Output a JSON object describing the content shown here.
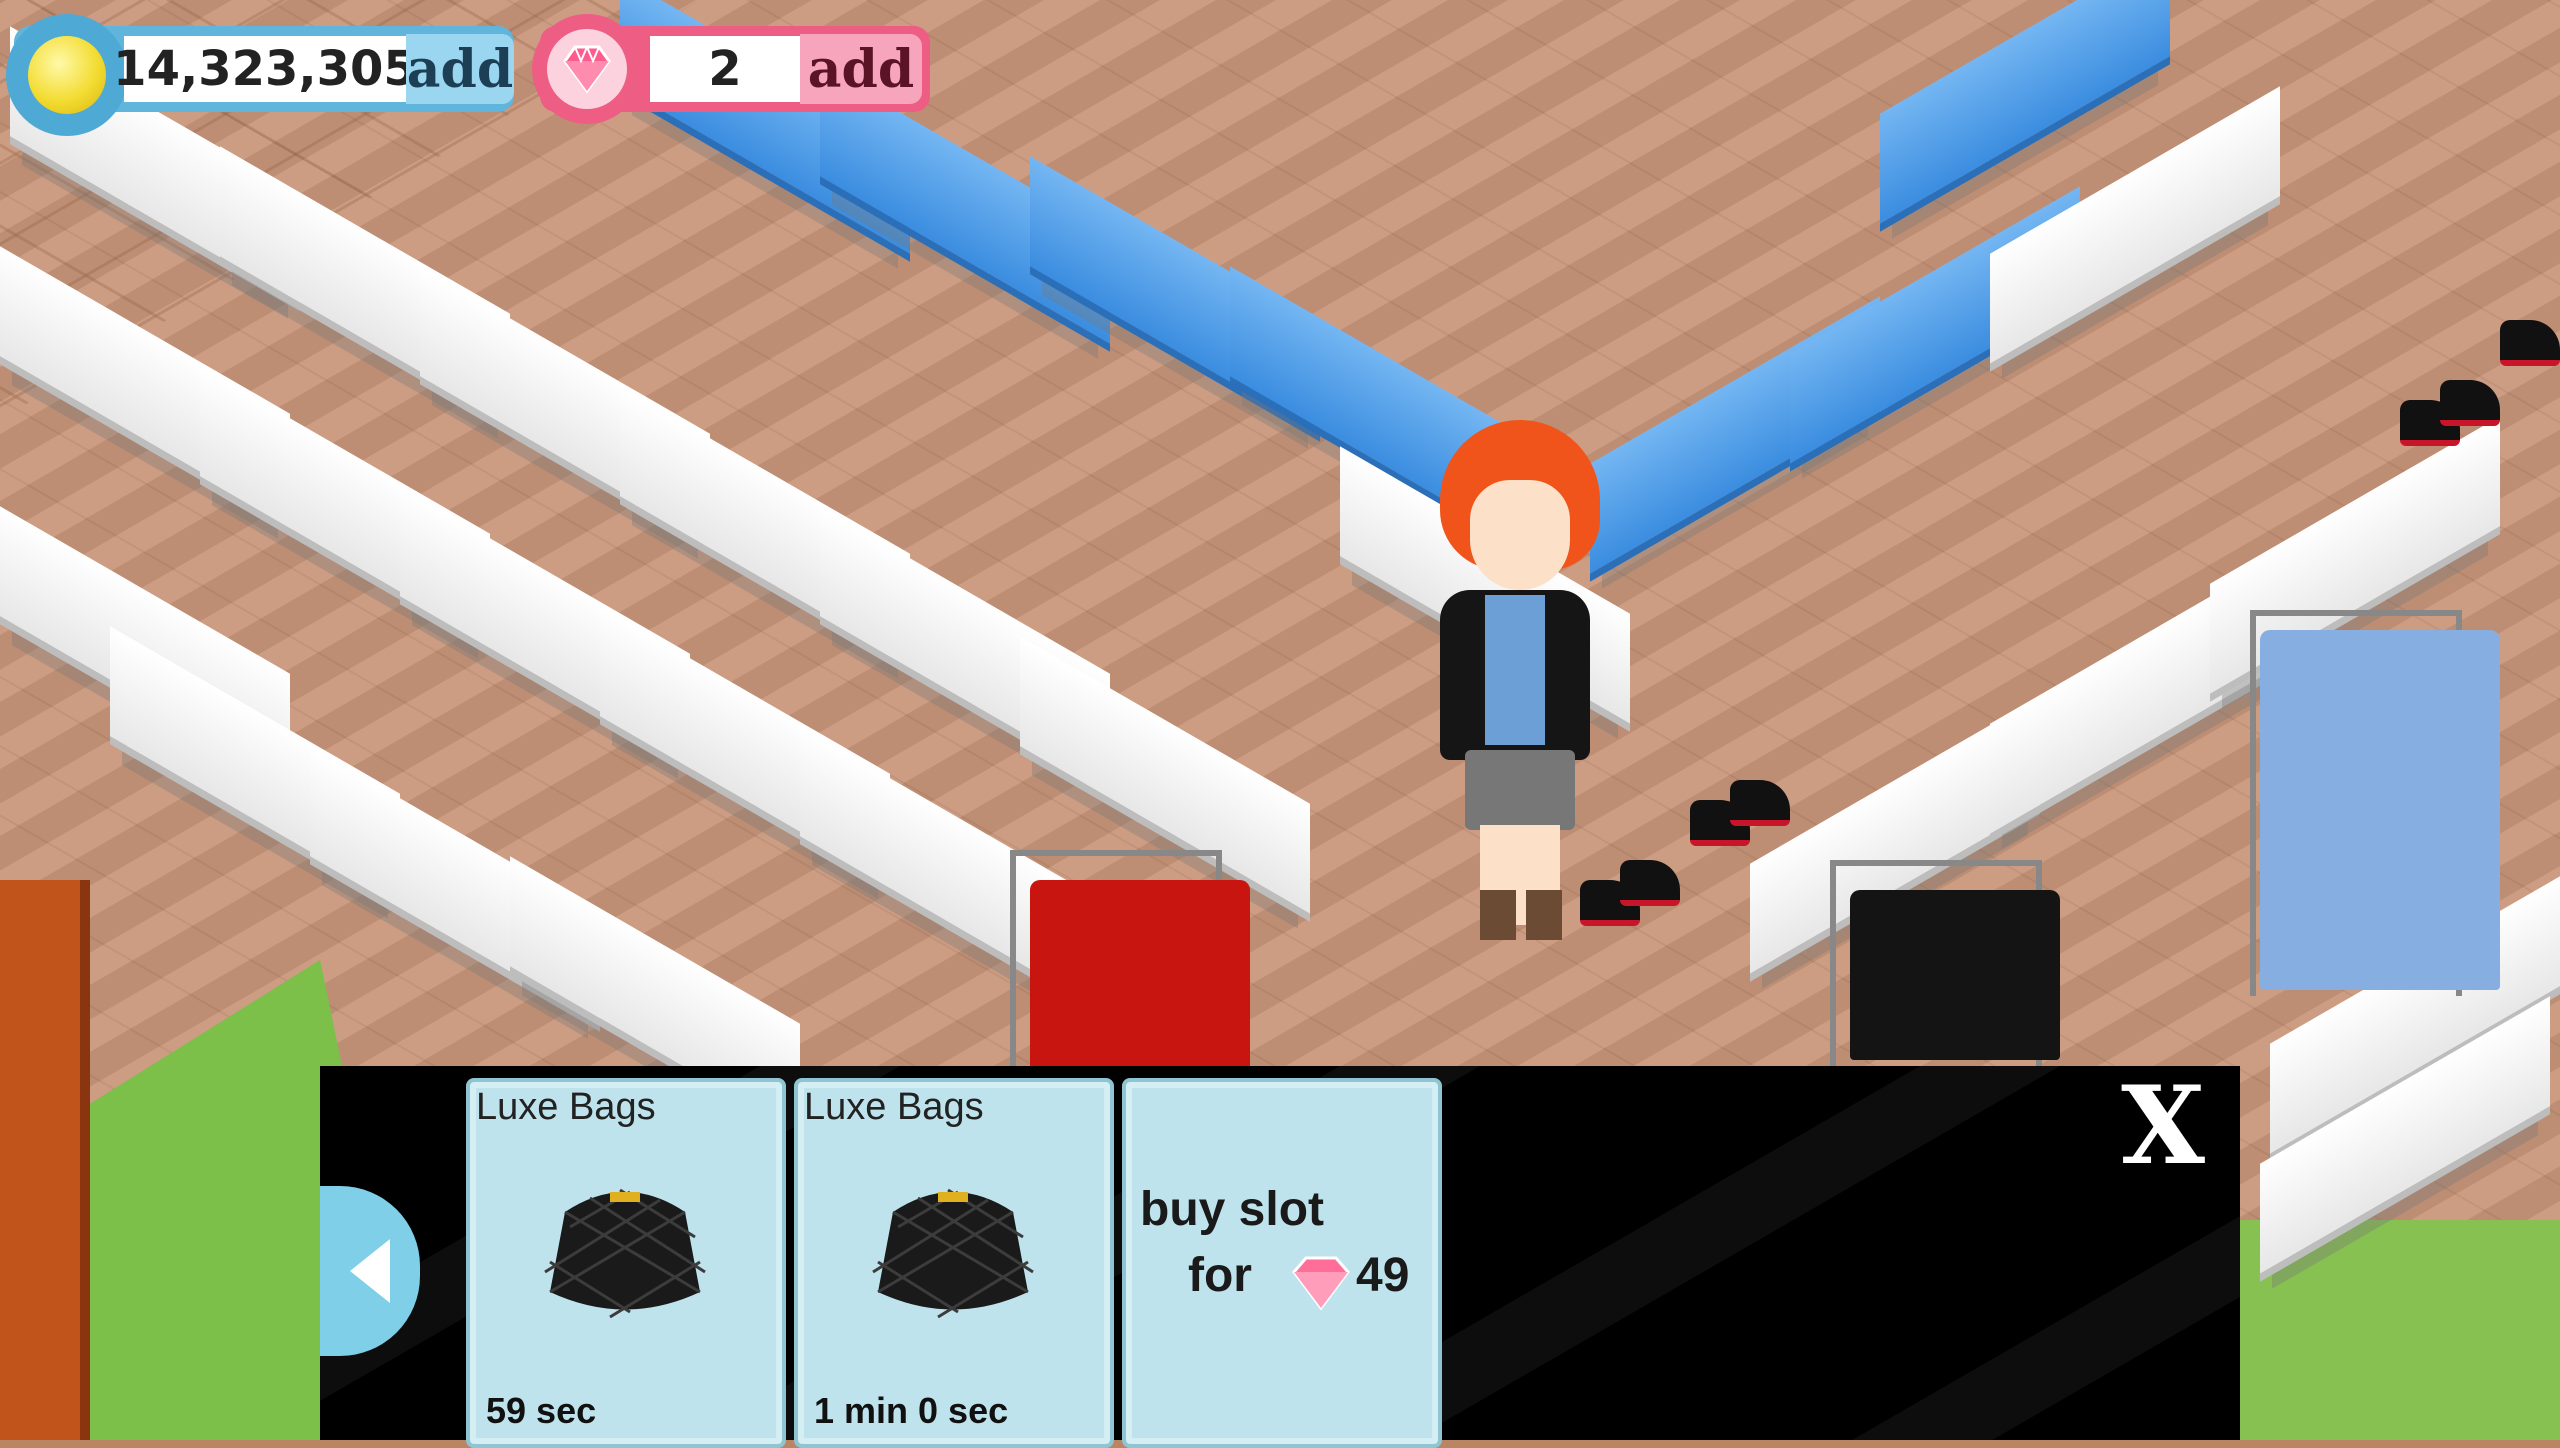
{
  "hud": {
    "coins": {
      "value": "14,323,305",
      "add_label": "add",
      "icon": "gold-coin-icon"
    },
    "gems": {
      "value": "2",
      "add_label": "add",
      "icon": "pink-gem-icon"
    }
  },
  "panel": {
    "slots": [
      {
        "title": "Luxe Bags",
        "time": "59 sec",
        "icon": "black-quilted-bag-icon"
      },
      {
        "title": "Luxe Bags",
        "time": "1 min 0 sec",
        "icon": "black-quilted-bag-icon"
      }
    ],
    "buy_slot": {
      "line1": "buy slot",
      "line2": "for",
      "price": "49",
      "icon": "pink-gem-icon"
    },
    "close_label": "X",
    "back_icon": "left-arrow-icon"
  },
  "colors": {
    "coin_bar": "#5fb5dc",
    "gem_bar": "#ee5d83",
    "slot_bg": "#bfe3ec",
    "panel_bg": "#000000"
  }
}
